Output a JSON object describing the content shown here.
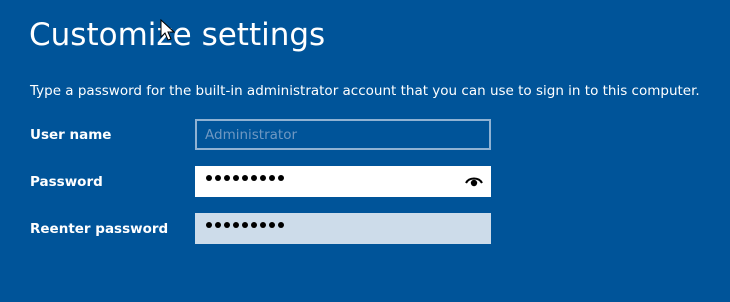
{
  "title": "Customize settings",
  "description": "Type a password for the built-in administrator account that you can use to sign in to this computer.",
  "fields": {
    "username": {
      "label": "User name",
      "value": "Administrator"
    },
    "password": {
      "label": "Password",
      "masked_length": 9,
      "reveal_icon": "eye-icon"
    },
    "reenter": {
      "label": "Reenter password",
      "masked_length": 9
    }
  },
  "colors": {
    "background": "#005499",
    "text": "#ffffff",
    "input_active": "#ffffff",
    "input_inactive": "#cddcea",
    "input_disabled_border": "#8fb2d3"
  }
}
